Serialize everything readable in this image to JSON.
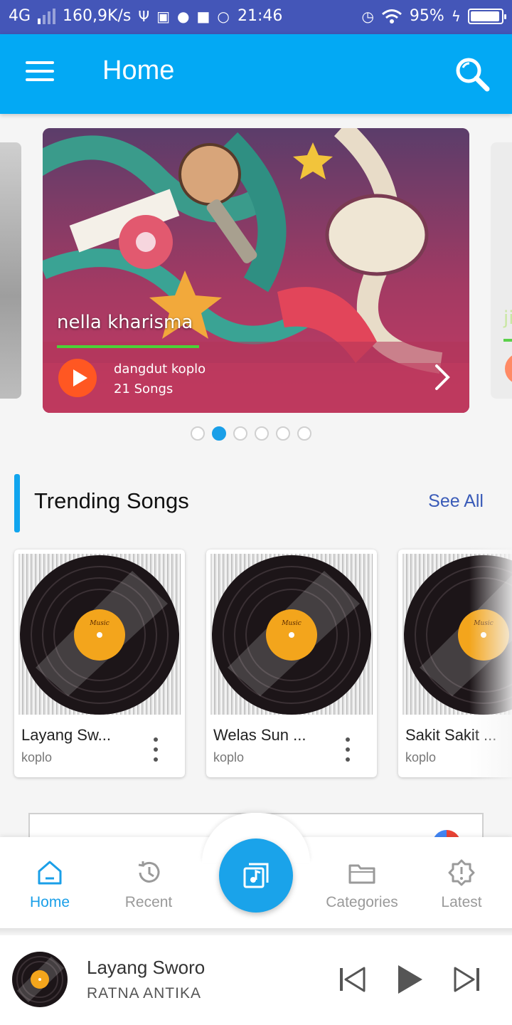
{
  "status_bar": {
    "network": "4G",
    "speed": "160,9K/s",
    "time": "21:46",
    "battery": "95%",
    "battery_level": 0.95
  },
  "app_bar": {
    "title": "Home",
    "menu_icon": "hamburger-icon",
    "search_icon": "search-icon"
  },
  "featured": {
    "artist": "nella kharisma",
    "genre": "dangdut koplo",
    "songs": "21 Songs",
    "pages": 6,
    "active_page": 2,
    "next_peek_text": "ji"
  },
  "trending": {
    "title": "Trending Songs",
    "see_all": "See All",
    "songs": [
      {
        "name": "Layang Sw...",
        "genre": "koplo"
      },
      {
        "name": "Welas Sun ...",
        "genre": "koplo"
      },
      {
        "name": "Sakit Sakit ...",
        "genre": "koplo"
      }
    ],
    "vinyl_label": "Music"
  },
  "bottom_nav": {
    "items": [
      {
        "label": "Home",
        "icon": "home-icon",
        "active": true
      },
      {
        "label": "Recent",
        "icon": "history-icon",
        "active": false
      },
      {
        "label": "Categories",
        "icon": "folder-icon",
        "active": false
      },
      {
        "label": "Latest",
        "icon": "alert-badge-icon",
        "active": false
      }
    ],
    "center_icon": "music-library-icon"
  },
  "player": {
    "title": "Layang Sworo",
    "artist": "RATNA ANTIKA"
  },
  "colors": {
    "status_bar": "#4456b8",
    "primary": "#03a9f4",
    "accent": "#1a9fe8",
    "play_button": "#ff5722",
    "underline": "#4cd137"
  }
}
